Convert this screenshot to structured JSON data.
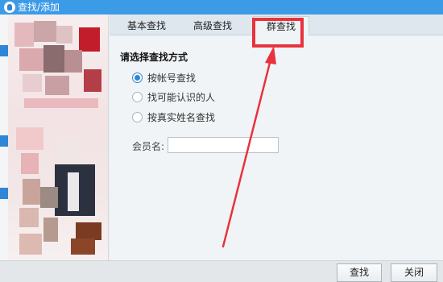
{
  "window": {
    "title": "查找/添加"
  },
  "tabs": [
    {
      "label": "基本查找",
      "active": false
    },
    {
      "label": "高级查找",
      "active": false
    },
    {
      "label": "群查找",
      "active": true
    }
  ],
  "form": {
    "heading": "请选择查找方式",
    "options": [
      {
        "label": "按帐号查找",
        "checked": true
      },
      {
        "label": "找可能认识的人",
        "checked": false
      },
      {
        "label": "按真实姓名查找",
        "checked": false
      }
    ],
    "member_label": "会员名:",
    "member_value": ""
  },
  "footer": {
    "find_label": "查找",
    "close_label": "关闭"
  },
  "colors": {
    "titlebar": "#3c9be7",
    "accent": "#2f86d6",
    "highlight": "#e8323d"
  }
}
